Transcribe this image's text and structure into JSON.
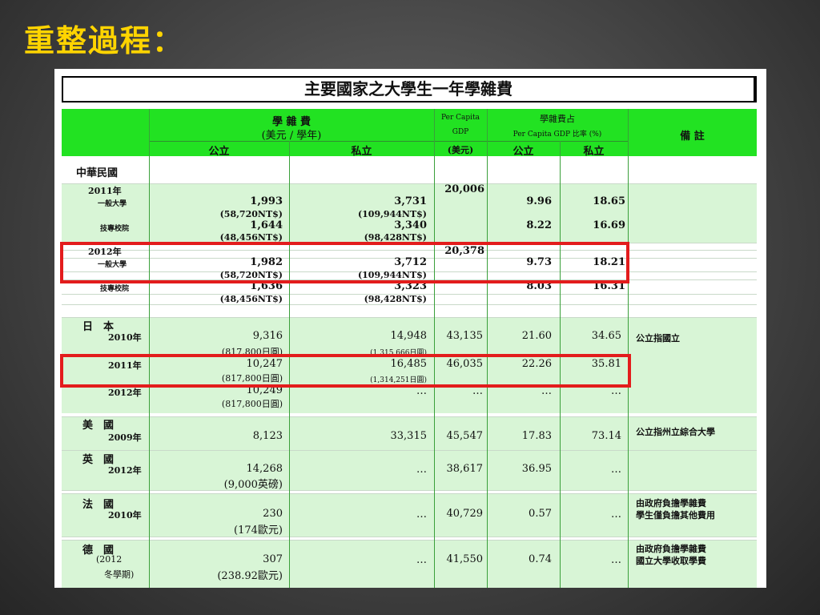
{
  "slide": {
    "title": "重整過程："
  },
  "table": {
    "title": "主要國家之大學生一年學雜費",
    "header": {
      "tuition_line1": "學  雜  費",
      "tuition_line2": "(美元 / 學年)",
      "public": "公立",
      "private": "私立",
      "gdp_line1": "Per Capita",
      "gdp_line2": "GDP",
      "gdp_unit": "(美元)",
      "ratio_line1": "學雜費占",
      "ratio_line2": "Per Capita GDP 比率 (%)",
      "ratio_public": "公立",
      "ratio_private": "私立",
      "remarks": "備    註"
    },
    "roc": {
      "country": "中華民國",
      "y2011": "2011年",
      "general_univ": "一般大學",
      "tech_college": "技專校院",
      "r2011_gen_pub": "1,993",
      "r2011_gen_pub_ntd": "(58,720NT$)",
      "r2011_gen_priv": "3,731",
      "r2011_gen_priv_ntd": "(109,944NT$)",
      "r2011_gdp": "20,006",
      "r2011_gen_ratio_pub": "9.96",
      "r2011_gen_ratio_priv": "18.65",
      "r2011_tech_pub": "1,644",
      "r2011_tech_pub_ntd": "(48,456NT$)",
      "r2011_tech_priv": "3,340",
      "r2011_tech_priv_ntd": "(98,428NT$)",
      "r2011_tech_ratio_pub": "8.22",
      "r2011_tech_ratio_priv": "16.69",
      "y2012": "2012年",
      "r2012_gen_pub": "1,982",
      "r2012_gen_pub_ntd": "(58,720NT$)",
      "r2012_gen_priv": "3,712",
      "r2012_gen_priv_ntd": "(109,944NT$)",
      "r2012_gdp": "20,378",
      "r2012_gen_ratio_pub": "9.73",
      "r2012_gen_ratio_priv": "18.21",
      "r2012_tech_pub": "1,636",
      "r2012_tech_pub_ntd": "(48,456NT$)",
      "r2012_tech_priv": "3,323",
      "r2012_tech_priv_ntd": "(98,428NT$)",
      "r2012_tech_ratio_pub": "8.03",
      "r2012_tech_ratio_priv": "16.31"
    },
    "japan": {
      "country": "日　本",
      "y2010": "2010年",
      "r2010_pub": "9,316",
      "r2010_pub_jpy": "(817,800日圓)",
      "r2010_priv": "14,948",
      "r2010_priv_jpy": "(1,315,666日圓)",
      "r2010_gdp": "43,135",
      "r2010_ratio_pub": "21.60",
      "r2010_ratio_priv": "34.65",
      "remark": "公立指國立",
      "y2011": "2011年",
      "r2011_pub": "10,247",
      "r2011_pub_jpy": "(817,800日圓)",
      "r2011_priv": "16,485",
      "r2011_priv_jpy": "(1,314,251日圓)",
      "r2011_gdp": "46,035",
      "r2011_ratio_pub": "22.26",
      "r2011_ratio_priv": "35.81",
      "y2012": "2012年",
      "r2012_pub": "10,249",
      "r2012_pub_jpy": "(817,800日圓)",
      "r2012_priv": "…",
      "r2012_gdp": "…",
      "r2012_ratio_pub": "…",
      "r2012_ratio_priv": "…"
    },
    "usa": {
      "country": "美　國",
      "year": "2009年",
      "pub": "8,123",
      "priv": "33,315",
      "gdp": "45,547",
      "ratio_pub": "17.83",
      "ratio_priv": "73.14",
      "remark": "公立指州立綜合大學"
    },
    "uk": {
      "country": "英　國",
      "year": "2012年",
      "pub": "14,268",
      "pub_local": "(9,000英磅)",
      "priv": "…",
      "gdp": "38,617",
      "ratio_pub": "36.95",
      "ratio_priv": "…"
    },
    "france": {
      "country": "法　國",
      "year": "2010年",
      "pub": "230",
      "pub_local": "(174歐元)",
      "priv": "…",
      "gdp": "40,729",
      "ratio_pub": "0.57",
      "ratio_priv": "…",
      "remark1": "由政府負擔學雜費",
      "remark2": "學生僅負擔其他費用"
    },
    "germany": {
      "country": "德　國",
      "year1": "(2012",
      "year2": "冬學期)",
      "pub": "307",
      "pub_local": "(238.92歐元)",
      "priv": "…",
      "gdp": "41,550",
      "ratio_pub": "0.74",
      "ratio_priv": "…",
      "remark1": "由政府負擔學雜費",
      "remark2": "國立大學收取學費"
    }
  },
  "colors": {
    "header_green": "#22e222",
    "row_green": "#d8f5d6",
    "highlight_red": "#e31c1c",
    "title_yellow": "#ffd400"
  }
}
